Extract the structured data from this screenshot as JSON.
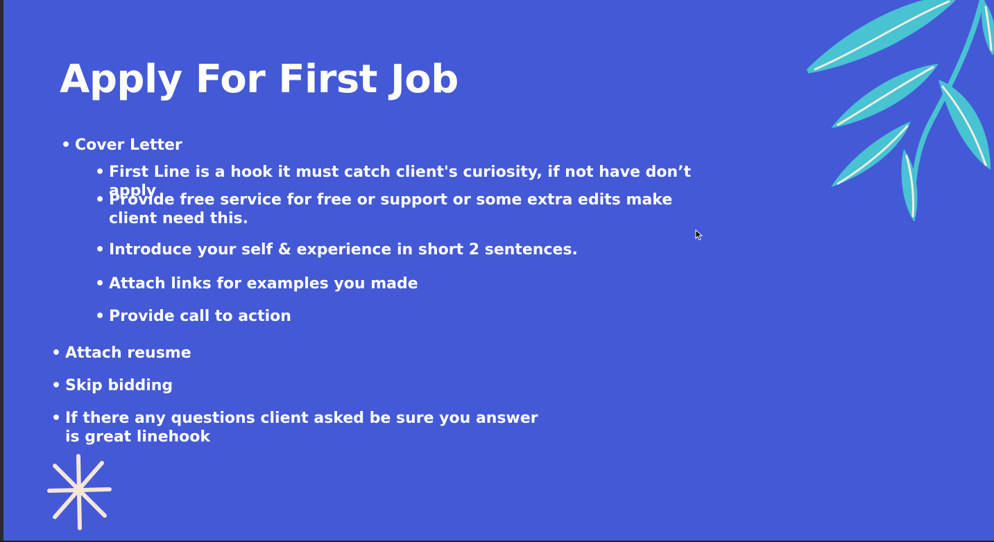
{
  "slide": {
    "title": "Apply For First Job",
    "bullets": {
      "cover_letter": "Cover Letter",
      "sub_items": [
        " First Line is a hook it must catch client's curiosity, if not have don’t apply",
        "Provide free service for free or support or some extra edits make client need this.",
        "Introduce your self & experience in short 2 sentences.",
        "Attach links for examples you made",
        "Provide call to action"
      ],
      "attach_resume": "Attach reusme",
      "skip_bidding": "Skip bidding",
      "questions": "If there any questions client asked be sure you answer is great linehook"
    }
  },
  "colors": {
    "background": "#4459d6",
    "text": "#ffffff",
    "leaf": "#47c3d2",
    "sparkle": "#f4e6d8"
  },
  "icons": {
    "leaf_decoration": "leaf-branch-icon",
    "sparkle_decoration": "sparkle-star-icon",
    "cursor": "mouse-pointer-icon"
  }
}
